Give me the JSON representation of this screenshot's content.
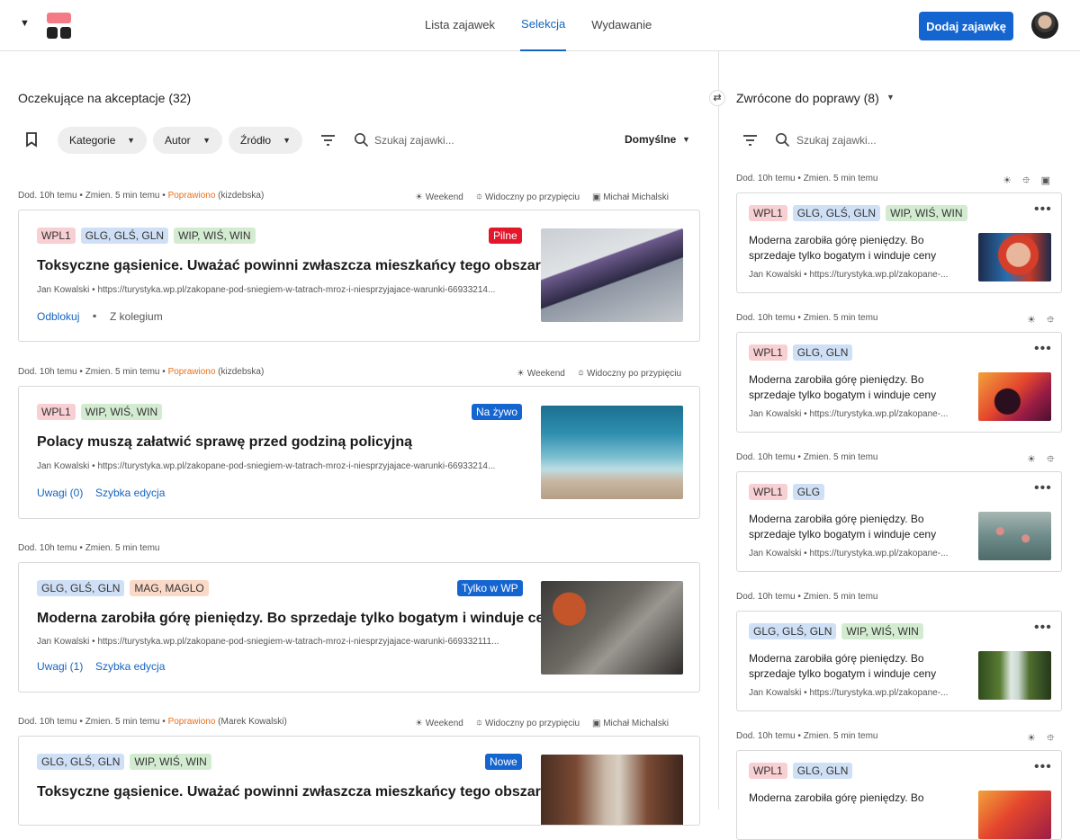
{
  "header": {
    "nav": [
      "Lista zajawek",
      "Selekcja",
      "Wydawanie"
    ],
    "add_button": "Dodaj zajawkę"
  },
  "left": {
    "title": "Oczekujące na akceptacje (32)",
    "filters": [
      "Kategorie",
      "Autor",
      "Źródło"
    ],
    "search_placeholder": "Szukaj zajawki...",
    "sort": "Domyślne",
    "cards": [
      {
        "meta_added": "Dod. 10h temu",
        "meta_changed": "Zmien. 5 min temu",
        "meta_status": "Poprawiono",
        "meta_by": "(kizdebska)",
        "flag_weekend": "Weekend",
        "flag_visible": "Widoczny po przypięciu",
        "flag_lock": "Michał Michalski",
        "tags": [
          "WPL1",
          "GLG, GLŚ, GLN",
          "WIP, WIŚ, WIN"
        ],
        "badge": "Pilne",
        "title": "Toksyczne gąsienice. Uważać powinni zwłaszcza mieszkańcy tego obszaru",
        "author": "Jan Kowalski",
        "url": "https://turystyka.wp.pl/zakopane-pod-sniegiem-w-tatrach-mroz-i-niesprzyjajace-warunki-66933214...",
        "action1": "Odblokuj",
        "action2": "Z kolegium"
      },
      {
        "meta_added": "Dod. 10h temu",
        "meta_changed": "Zmien. 5 min temu",
        "meta_status": "Poprawiono",
        "meta_by": "(kizdebska)",
        "flag_weekend": "Weekend",
        "flag_visible": "Widoczny po przypięciu",
        "tags": [
          "WPL1",
          "WIP, WIŚ, WIN"
        ],
        "badge": "Na żywo",
        "title": "Polacy muszą załatwić sprawę przed godziną policyjną",
        "author": "Jan Kowalski",
        "url": "https://turystyka.wp.pl/zakopane-pod-sniegiem-w-tatrach-mroz-i-niesprzyjajace-warunki-66933214...",
        "action1": "Uwagi (0)",
        "action2": "Szybka edycja"
      },
      {
        "meta_added": "Dod. 10h temu",
        "meta_changed": "Zmien. 5 min temu",
        "tags": [
          "GLG, GLŚ, GLN",
          "MAG, MAGLO"
        ],
        "badge": "Tylko w WP",
        "title": "Moderna zarobiła górę pieniędzy. Bo sprzedaje tylko bogatym i winduje ceny",
        "author": "Jan Kowalski",
        "url": "https://turystyka.wp.pl/zakopane-pod-sniegiem-w-tatrach-mroz-i-niesprzyjajace-warunki-669332111...",
        "action1": "Uwagi (1)",
        "action2": "Szybka edycja"
      },
      {
        "meta_added": "Dod. 10h temu",
        "meta_changed": "Zmien. 5 min temu",
        "meta_status": "Poprawiono",
        "meta_by": "(Marek Kowalski)",
        "flag_weekend": "Weekend",
        "flag_visible": "Widoczny po przypięciu",
        "flag_lock": "Michał Michalski",
        "tags": [
          "GLG, GLŚ, GLN",
          "WIP, WIŚ, WIN"
        ],
        "badge": "Nowe",
        "title": "Toksyczne gąsienice. Uważać powinni zwłaszcza mieszkańcy tego obszaru"
      }
    ]
  },
  "right": {
    "title": "Zwrócone do poprawy (8)",
    "search_placeholder": "Szukaj zajawki...",
    "cards": [
      {
        "meta_added": "Dod. 10h temu",
        "meta_changed": "Zmien. 5 min temu",
        "tags": [
          "WPL1",
          "GLG, GLŚ, GLN",
          "WIP, WIŚ, WIN"
        ],
        "title": "Moderna zarobiła górę pieniędzy. Bo sprzedaje tylko bogatym i winduje ceny",
        "author": "Jan Kowalski",
        "url": "https://turystyka.wp.pl/zakopane-..."
      },
      {
        "meta_added": "Dod. 10h temu",
        "meta_changed": "Zmien. 5 min temu",
        "tags": [
          "WPL1",
          "GLG, GLN"
        ],
        "title": "Moderna zarobiła górę pieniędzy. Bo sprzedaje tylko bogatym i winduje ceny",
        "author": "Jan Kowalski",
        "url": "https://turystyka.wp.pl/zakopane-..."
      },
      {
        "meta_added": "Dod. 10h temu",
        "meta_changed": "Zmien. 5 min temu",
        "tags": [
          "WPL1",
          "GLG"
        ],
        "title": "Moderna zarobiła górę pieniędzy. Bo sprzedaje tylko bogatym i winduje ceny",
        "author": "Jan Kowalski",
        "url": "https://turystyka.wp.pl/zakopane-..."
      },
      {
        "meta_added": "Dod. 10h temu",
        "meta_changed": "Zmien. 5 min temu",
        "tags": [
          "GLG, GLŚ, GLN",
          "WIP, WIŚ, WIN"
        ],
        "title": "Moderna zarobiła górę pieniędzy. Bo sprzedaje tylko bogatym i winduje ceny",
        "author": "Jan Kowalski",
        "url": "https://turystyka.wp.pl/zakopane-..."
      },
      {
        "meta_added": "Dod. 10h temu",
        "meta_changed": "Zmien. 5 min temu",
        "tags": [
          "WPL1",
          "GLG, GLN"
        ],
        "title": "Moderna zarobiła górę pieniędzy. Bo"
      }
    ]
  },
  "colors": {
    "accent": "#1565d0",
    "urgent": "#e3162b",
    "status": "#e8701a"
  },
  "symbols": {
    "dot": "•",
    "sun": "☀",
    "pin": "📌",
    "lock": "🔒"
  }
}
